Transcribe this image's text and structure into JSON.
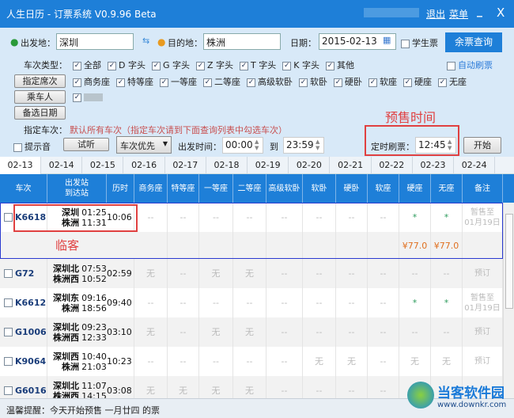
{
  "window": {
    "title": "人生日历 - 订票系统 V0.9.96 Beta",
    "logout": "退出",
    "menu": "菜单",
    "minimize": "_",
    "close": "X"
  },
  "search": {
    "from_label": "出发地：",
    "from_value": "深圳",
    "to_label": "目的地：",
    "to_value": "株洲",
    "date_label": "日期：",
    "date_value": "2015-02-13",
    "student_label": "学生票",
    "query_button": "余票查询"
  },
  "train_types": {
    "label": "车次类型：",
    "items": [
      "全部",
      "D 字头",
      "G 字头",
      "Z 字头",
      "T 字头",
      "K 字头",
      "其他"
    ],
    "auto_refresh": "自动刷票"
  },
  "seat_button": "指定席次",
  "seats": [
    "商务座",
    "特等座",
    "一等座",
    "二等座",
    "高级软卧",
    "软卧",
    "硬卧",
    "软座",
    "硬座",
    "无座"
  ],
  "passenger_button": "乘车人",
  "alt_date_button": "备选日期",
  "specified": {
    "label": "指定车次：",
    "value": "默认所有车次（指定车次请到下面查询列表中勾选车次）"
  },
  "annotation_presale": "预售时间",
  "controls": {
    "sound_label": "提示音",
    "listen_button": "试听",
    "priority": "车次优先",
    "depart_label": "出发时间：",
    "time_from": "00:00",
    "to_label": "到",
    "time_to": "23:59",
    "timed_label": "定时刷票：",
    "timed_value": "12:45",
    "start_button": "开始"
  },
  "date_tabs": [
    "02-13",
    "02-14",
    "02-15",
    "02-16",
    "02-17",
    "02-18",
    "02-19",
    "02-20",
    "02-21",
    "02-22",
    "02-23",
    "02-24"
  ],
  "active_tab": "02-13",
  "headers": [
    "车次",
    "出发站\n到达站",
    "历时",
    "商务座",
    "特等座",
    "一等座",
    "二等座",
    "高级软卧",
    "软卧",
    "硬卧",
    "软座",
    "硬座",
    "无座",
    "备注"
  ],
  "rows": [
    {
      "train": "K6618",
      "from": "深圳",
      "to": "株洲",
      "dep": "01:25",
      "arr": "11:31",
      "duration": "10:06",
      "seats": [
        "--",
        "--",
        "--",
        "--",
        "--",
        "--",
        "--",
        "--",
        "*",
        "*"
      ],
      "remark": "暂售至\n01月19日",
      "prices": [
        "",
        "",
        "",
        "",
        "",
        "",
        "",
        "",
        "¥77.0",
        "¥77.0"
      ],
      "annotation": "临客"
    },
    {
      "train": "G72",
      "from": "深圳北",
      "to": "株洲西",
      "dep": "07:53",
      "arr": "10:52",
      "duration": "02:59",
      "seats": [
        "无",
        "--",
        "无",
        "无",
        "--",
        "--",
        "--",
        "--",
        "--",
        "--"
      ],
      "remark": "预订"
    },
    {
      "train": "K6612",
      "from": "深圳东",
      "to": "株洲",
      "dep": "09:16",
      "arr": "18:56",
      "duration": "09:40",
      "seats": [
        "--",
        "--",
        "--",
        "--",
        "--",
        "--",
        "--",
        "--",
        "*",
        "*"
      ],
      "remark": "暂售至\n01月19日"
    },
    {
      "train": "G1006",
      "from": "深圳北",
      "to": "株洲西",
      "dep": "09:23",
      "arr": "12:33",
      "duration": "03:10",
      "seats": [
        "无",
        "--",
        "无",
        "无",
        "--",
        "--",
        "--",
        "--",
        "--",
        "--"
      ],
      "remark": "预订"
    },
    {
      "train": "K9064",
      "from": "深圳西",
      "to": "株洲",
      "dep": "10:40",
      "arr": "21:03",
      "duration": "10:23",
      "seats": [
        "--",
        "--",
        "--",
        "--",
        "--",
        "无",
        "无",
        "--",
        "无",
        "无"
      ],
      "remark": "预订"
    },
    {
      "train": "G6016",
      "from": "深圳北",
      "to": "株洲西",
      "dep": "11:07",
      "arr": "14:15",
      "duration": "03:08",
      "seats": [
        "无",
        "无",
        "无",
        "无",
        "--",
        "--",
        "--",
        "--",
        "",
        ""
      ],
      "remark": ""
    }
  ],
  "status": "温馨提醒：今天开始预售 一月廿四 的票",
  "watermark": {
    "name": "当客软件园",
    "url": "www.downkr.com"
  },
  "colors": {
    "accent": "#1e7fd8",
    "annotation": "#e04040",
    "price": "#e07020",
    "available": "#2a9a5a"
  }
}
